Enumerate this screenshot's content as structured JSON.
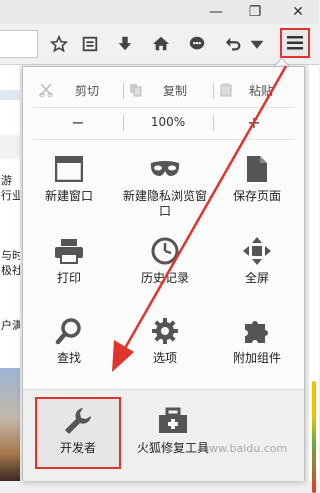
{
  "window": {
    "minimize_icon": "minimize-icon",
    "restore_icon": "restore-icon",
    "close_icon": "close-icon"
  },
  "toolbar": {
    "icons": [
      "bookmark-star-icon",
      "reading-list-icon",
      "download-arrow-icon",
      "home-icon",
      "chat-bubble-icon",
      "undo-arrow-icon",
      "dropdown-caret-icon",
      "menu-hamburger-icon"
    ]
  },
  "left_page": {
    "fragments": [
      "游",
      "行业",
      "与时",
      "极社",
      "户满"
    ]
  },
  "menu": {
    "edit": {
      "cut": "剪切",
      "copy": "复制",
      "paste": "粘贴"
    },
    "zoom": {
      "minus": "−",
      "value": "100%",
      "plus": "+"
    },
    "items": [
      {
        "label": "新建窗口",
        "icon": "new-window-icon"
      },
      {
        "label": "新建隐私浏览窗口",
        "icon": "private-mask-icon"
      },
      {
        "label": "保存页面",
        "icon": "save-page-icon"
      },
      {
        "label": "打印",
        "icon": "printer-icon"
      },
      {
        "label": "历史记录",
        "icon": "history-clock-icon"
      },
      {
        "label": "全屏",
        "icon": "fullscreen-icon"
      },
      {
        "label": "查找",
        "icon": "search-icon"
      },
      {
        "label": "选项",
        "icon": "gear-icon"
      },
      {
        "label": "附加组件",
        "icon": "puzzle-icon"
      }
    ],
    "footer": [
      {
        "label": "开发者",
        "icon": "wrench-icon"
      },
      {
        "label": "火狐修复工具",
        "icon": "toolbox-icon"
      }
    ]
  },
  "watermark": "www.baidu.com",
  "colors": {
    "highlight_red": "#e0342c",
    "icon_gray": "#555555"
  }
}
